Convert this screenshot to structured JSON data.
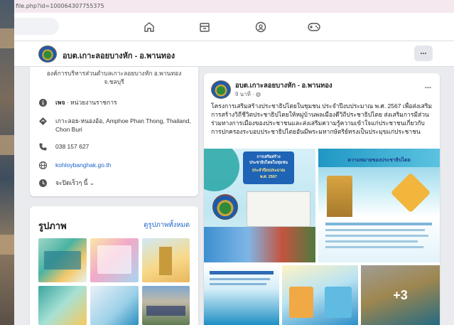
{
  "browser": {
    "url_fragment": "file.php?id=100064307755375"
  },
  "nav": {
    "icons": [
      "home-icon",
      "marketplace-icon",
      "groups-icon",
      "gaming-icon"
    ]
  },
  "page": {
    "name": "อบต.เกาะลอยบางหัก - อ.พานทอง",
    "more_label": "..."
  },
  "intro": {
    "org_line1": "องค์การบริหารส่วนตำบลเกาะลอยบางหัก อ.พานทอง",
    "org_line2": "จ.ชลบุรี",
    "category_prefix": "เพจ",
    "category": " · หน่วยงานราชการ",
    "address": "เกาะลอย-หนองอ้อ, Amphoe Phan Thong, Thailand, Chon Buri",
    "phone": "038 157 627",
    "website": "kohloybanghak.go.th",
    "hours": "จะปิดเร็วๆ นี้ ⌄"
  },
  "photos": {
    "title": "รูปภาพ",
    "see_all": "ดูรูปภาพทั้งหมด"
  },
  "post": {
    "author": "อบต.เกาะลอยบางหัก - อ.พานทอง",
    "time": "9 นาที · ◍",
    "more_label": "...",
    "text": "โครงการเสริมสร้างประชาธิปไตยในชุมชน ประจำปีงบประมาณ พ.ศ. 2567 เพื่อส่งเสริมการสร้างวิถีชีวิตประชาธิปไตยให้หมู่บ้านพลเมืองดีวิถีประชาธิปไตย ส่งเสริมการมีส่วนร่วมทางการเมืองของประชาชนและส่งเสริมความรู้ความเข้าใจแก่ประชาชนเกี่ยวกับการปกครองระบอบประชาธิปไตยอันมีพระมหากษัตริย์ทรงเป็นประมุขแก่ประชาชน",
    "banner_line1": "การเสริมสร้าง",
    "banner_line2": "ประชาธิปไตยในชุมชน",
    "banner_line3": "ประจำปีงบประมาณ",
    "banner_line4": "พ.ศ. 2567",
    "info_heading": "ความหมายของประชาธิปไตย",
    "more_photos": "+3"
  },
  "colors": {
    "link": "#1b64c8",
    "background": "#e9ebee"
  }
}
